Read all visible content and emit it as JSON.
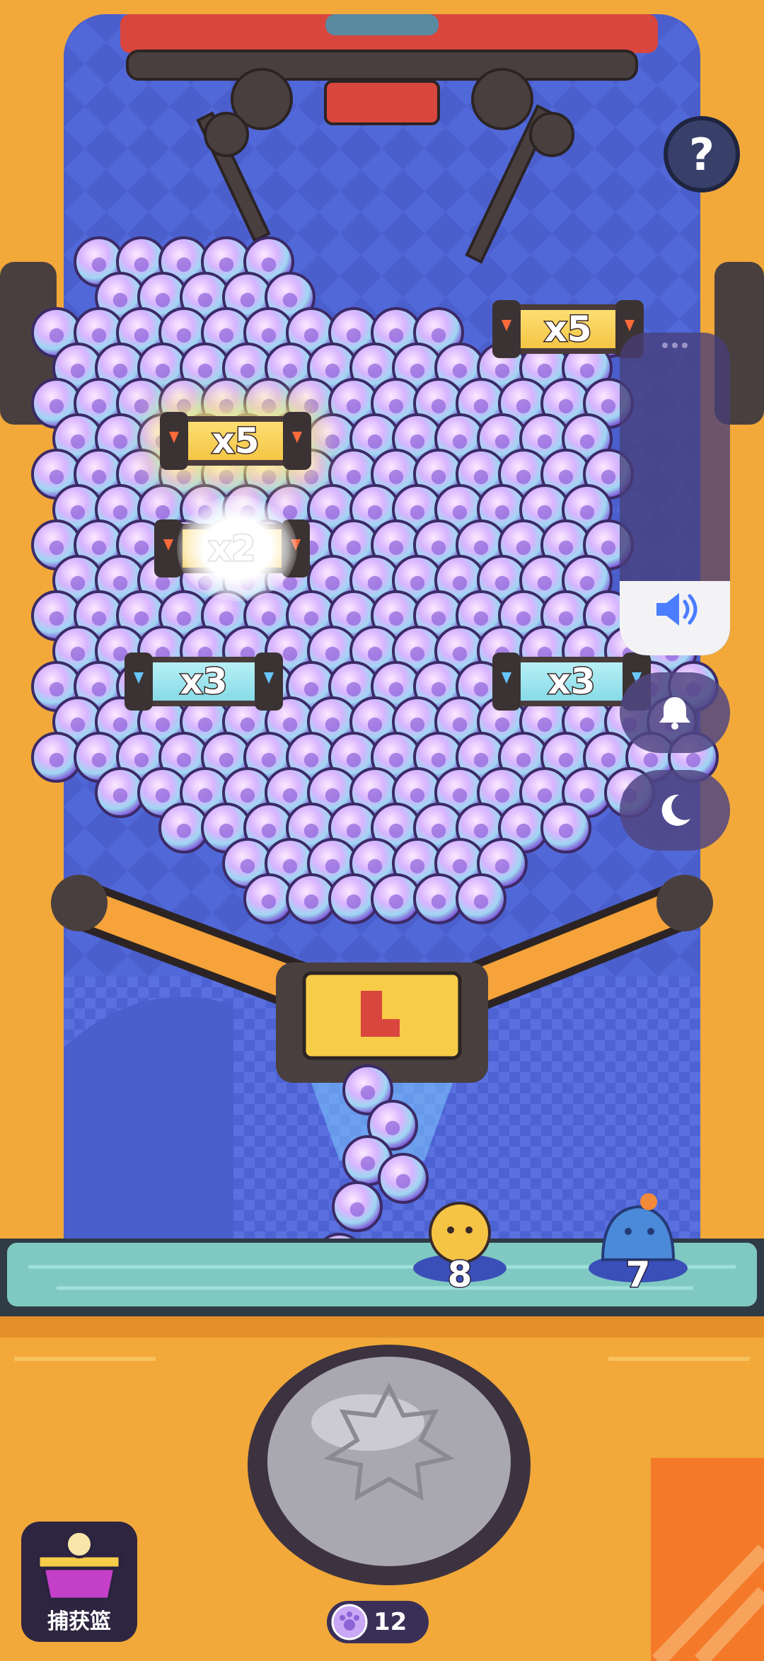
{
  "multipliers": [
    {
      "id": "x5-top-right",
      "label": "x5",
      "style": "gold"
    },
    {
      "id": "x5-left-glow",
      "label": "x5",
      "style": "gold"
    },
    {
      "id": "x2-left-hidden",
      "label": "x2",
      "style": "gold"
    },
    {
      "id": "x3-left",
      "label": "x3",
      "style": "aqua"
    },
    {
      "id": "x3-right",
      "label": "x3",
      "style": "aqua"
    }
  ],
  "help": {
    "label": "?"
  },
  "controls": {
    "volume_level": 0.23,
    "volume_icon": "speaker-icon",
    "bell_icon": "bell-icon",
    "moon_icon": "moon-icon"
  },
  "pets": [
    {
      "name": "dog",
      "count": "8"
    },
    {
      "name": "capybara",
      "count": "7"
    }
  ],
  "basket": {
    "label": "捕获篮",
    "icon": "basket-icon"
  },
  "coins": {
    "value": "12",
    "icon": "paw-coin-icon"
  },
  "colors": {
    "machine_orange": "#f2a93a",
    "back_blue": "#4a5fd0",
    "shelf_teal": "#7fc9c2"
  }
}
